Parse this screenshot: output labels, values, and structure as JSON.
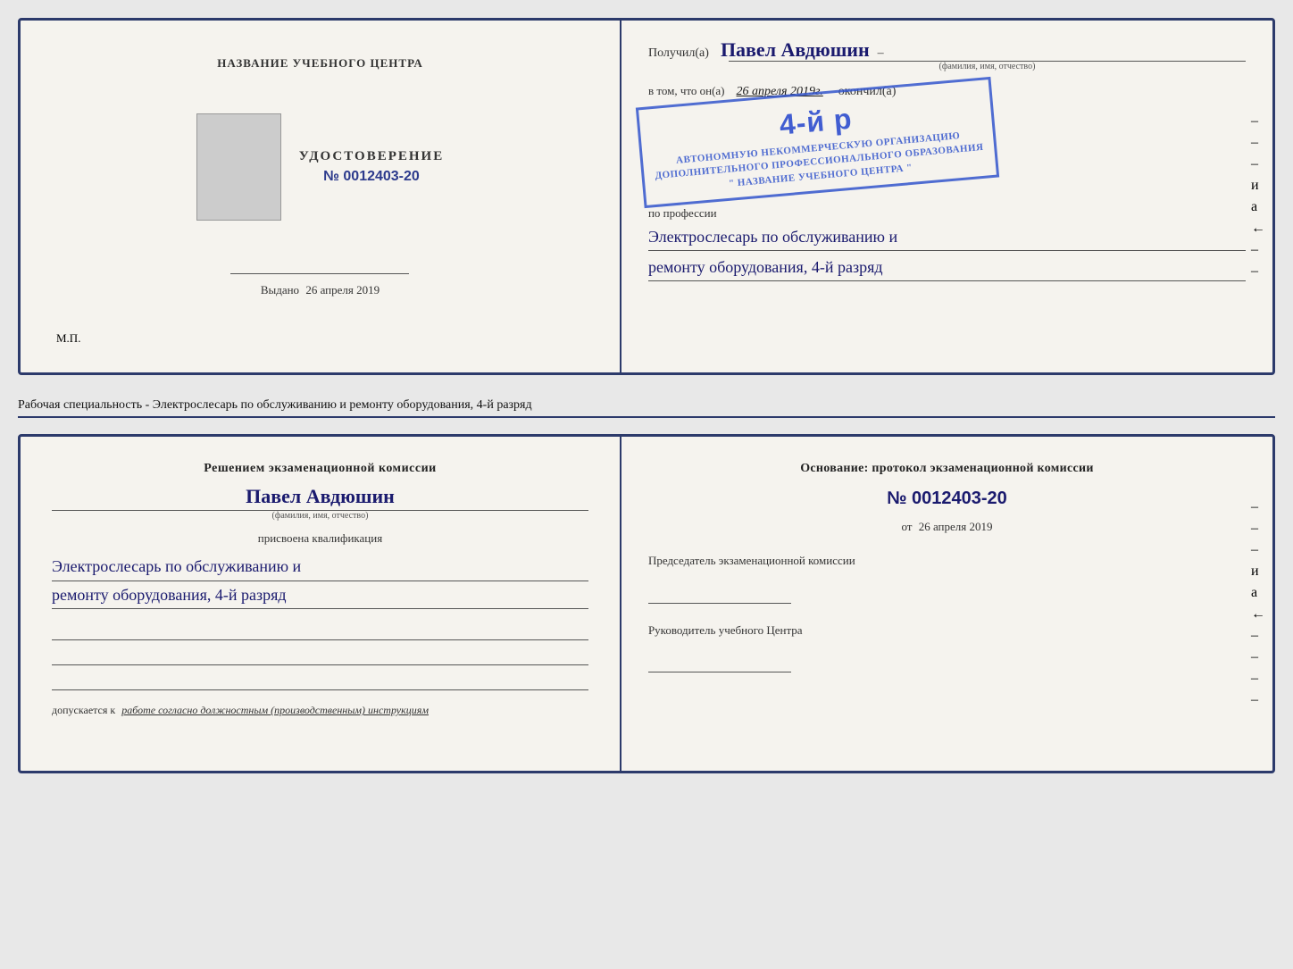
{
  "top_left": {
    "org_name": "НАЗВАНИЕ УЧЕБНОГО ЦЕНТРА",
    "cert_title": "УДОСТОВЕРЕНИЕ",
    "cert_number": "№ 0012403-20",
    "issued_label": "Выдано",
    "issued_date": "26 апреля 2019",
    "mp_label": "М.П."
  },
  "top_right": {
    "received_label": "Получил(а)",
    "recipient_name": "Павел Авдюшин",
    "fio_label": "(фамилия, имя, отчество)",
    "vtom_label": "в том, что он(а)",
    "date_handwritten": "26 апреля 2019г.",
    "okonchil_label": "окончил(а)",
    "stamp_line1": "4-й р",
    "stamp_line2": "АВТОНОМНУЮ НЕКОММЕРЧЕСКУЮ ОРГАНИЗАЦИЮ",
    "stamp_line3": "ДОПОЛНИТЕЛЬНОГО ПРОФЕССИОНАЛЬНОГО ОБРАЗОВАНИЯ",
    "stamp_line4": "\"    НАЗВАНИЕ УЧЕБНОГО ЦЕНТРА    \"",
    "profession_label": "по профессии",
    "profession_line1": "Электрослесарь по обслуживанию и",
    "profession_line2": "ремонту оборудования, 4-й разряд"
  },
  "separator": {
    "text": "Рабочая специальность - Электрослесарь по обслуживанию и ремонту оборудования, 4-й разряд"
  },
  "bottom_left": {
    "commission_title": "Решением экзаменационной комиссии",
    "person_name": "Павел Авдюшин",
    "fio_label": "(фамилия, имя, отчество)",
    "qualification_label": "присвоена квалификация",
    "qualification_line1": "Электрослесарь по обслуживанию и",
    "qualification_line2": "ремонту оборудования, 4-й разряд",
    "допускается_prefix": "допускается к",
    "допускается_text": "работе согласно должностным (производственным) инструкциям"
  },
  "bottom_right": {
    "osnование_text": "Основание: протокол экзаменационной комиссии",
    "protocol_number": "№  0012403-20",
    "date_from_prefix": "от",
    "date_from": "26 апреля 2019",
    "chairman_title": "Председатель экзаменационной комиссии",
    "head_title": "Руководитель учебного Центра"
  },
  "edge_marks": [
    "–",
    "–",
    "–",
    "и",
    "а",
    "←",
    "–",
    "–",
    "–",
    "–"
  ]
}
